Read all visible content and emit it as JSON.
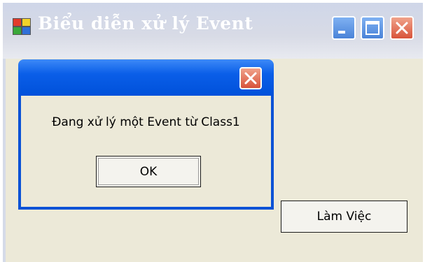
{
  "window": {
    "title": "Biểu diễn xử lý Event"
  },
  "main": {
    "button_label": "Làm Việc"
  },
  "dialog": {
    "message": "Đang xử lý một Event từ Class1",
    "ok_label": "OK"
  },
  "colors": {
    "titlebar_inactive": "#cfd6e8",
    "dialog_titlebar": "#0a5ee8",
    "client_bg": "#ece9d8",
    "close_button": "#d8533a"
  },
  "icons": {
    "app": "app-icon",
    "minimize": "minimize-icon",
    "maximize": "maximize-icon",
    "close": "close-icon"
  }
}
